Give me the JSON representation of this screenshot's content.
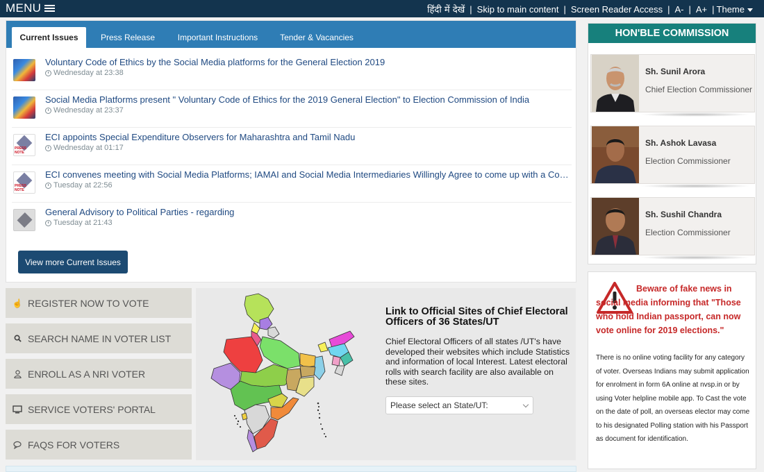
{
  "topbar": {
    "menu_label": "MENU",
    "hindi_label": "हिंदी में देखें",
    "skip_label": "Skip to main content",
    "reader_label": "Screen Reader Access",
    "font_minus": "A-",
    "font_plus": "A+",
    "theme_label": "Theme"
  },
  "tabs": [
    {
      "label": "Current Issues"
    },
    {
      "label": "Press Release"
    },
    {
      "label": "Important Instructions"
    },
    {
      "label": "Tender & Vacancies"
    }
  ],
  "news": [
    {
      "title": "Voluntary Code of Ethics by the Social Media platforms for the General Election 2019",
      "time": "Wednesday at 23:38",
      "icon": "social-media-thumbnail"
    },
    {
      "title": "Social Media Platforms present \" Voluntary Code of Ethics for the 2019 General Election\" to Election Commission of India",
      "time": "Wednesday at 23:37",
      "icon": "social-media-thumbnail"
    },
    {
      "title": "ECI appoints Special Expenditure Observers for Maharashtra and Tamil Nadu",
      "time": "Wednesday at 01:17",
      "icon": "press-note-thumbnail"
    },
    {
      "title": "ECI convenes meeting with Social Media Platforms; IAMAI and Social Media Intermediaries Willingly Agree to come up with a Code of Ethics for the General Election 2019",
      "time": "Tuesday at 22:56",
      "icon": "press-note-thumbnail"
    },
    {
      "title": "General Advisory to Political Parties - regarding",
      "time": "Tuesday at 21:43",
      "icon": "evm-thumbnail"
    }
  ],
  "press_note_label": "PRESS NOTE",
  "view_more_label": "View more Current Issues",
  "quick_links": [
    {
      "label": "REGISTER NOW TO VOTE",
      "icon": "hand-pointer-icon"
    },
    {
      "label": "SEARCH NAME IN VOTER LIST",
      "icon": "search-icon"
    },
    {
      "label": "ENROLL AS A NRI VOTER",
      "icon": "user-icon"
    },
    {
      "label": "SERVICE VOTERS' PORTAL",
      "icon": "monitor-icon"
    },
    {
      "label": "FAQS FOR VOTERS",
      "icon": "chat-icon"
    }
  ],
  "ceo": {
    "title": "Link to Official Sites of Chief Electoral Officers of 36 States/UT",
    "description": "Chief Electoral Officers of all states /UT's have developed their websites which include Statistics and information of local Interest. Latest electoral rolls with search facility are also available on these sites.",
    "select_placeholder": "Please select an State/UT:"
  },
  "commission": {
    "heading": "HON'BLE COMMISSION",
    "members": [
      {
        "name": "Sh. Sunil Arora",
        "role": "Chief Election Commissioner"
      },
      {
        "name": "Sh. Ashok Lavasa",
        "role": "Election Commissioner"
      },
      {
        "name": "Sh. Sushil Chandra",
        "role": "Election Commissioner"
      }
    ]
  },
  "fake_news": {
    "title": "Beware of fake news in social media informing that \"Those who hold Indian passport, can now vote online for 2019 elections.\"",
    "description": "There is no online voting facility for any category of voter. Overseas Indians may submit application for enrolment in form 6A online at nvsp.in or by using Voter helpline mobile app. To Cast the vote on the date of poll, an overseas elector may come to his designated Polling station with his Passport as document for identification."
  },
  "colors": {
    "topbar": "#13344e",
    "tabbar": "#2f7db5",
    "button": "#1c4a72",
    "commission": "#17807c",
    "alert": "#c62828"
  }
}
